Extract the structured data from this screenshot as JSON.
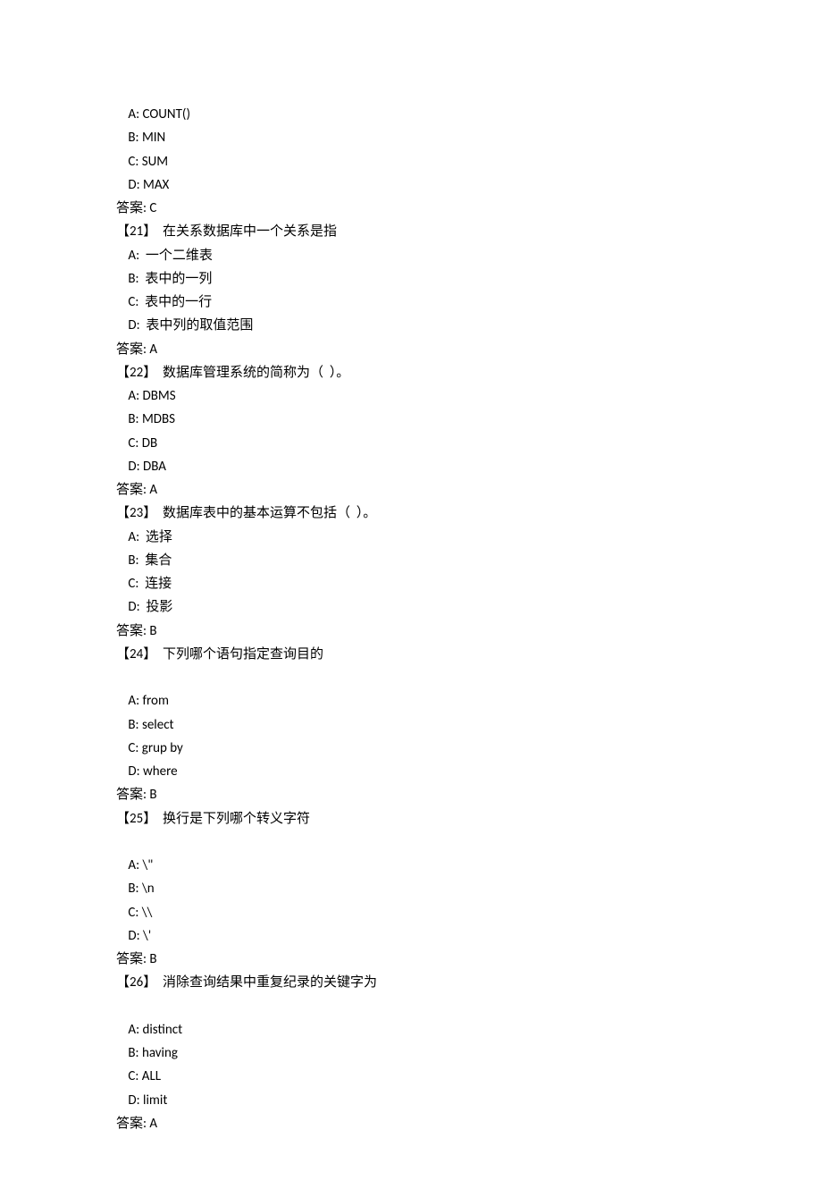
{
  "questions": [
    {
      "prior_options": [
        "A: COUNT()",
        "B: MIN",
        "C: SUM",
        "D: MAX"
      ],
      "answer_label": "答案: C"
    },
    {
      "header": "【21】  在关系数据库中一个关系是指",
      "options": [
        "A:  一个二维表",
        "B:  表中的一列",
        "C:  表中的一行",
        "D:  表中列的取值范围"
      ],
      "answer_label": "答案: A"
    },
    {
      "header": "【22】  数据库管理系统的简称为（  ）。",
      "options": [
        "A: DBMS",
        "B: MDBS",
        "C: DB",
        "D: DBA"
      ],
      "answer_label": "答案: A"
    },
    {
      "header": "【23】  数据库表中的基本运算不包括（  ）。",
      "options": [
        "A:  选择",
        "B:  集合",
        "C:  连接",
        "D:  投影"
      ],
      "answer_label": "答案: B"
    },
    {
      "header": "【24】  下列哪个语句指定查询目的",
      "blank_after_header": true,
      "options": [
        "A: from",
        "B: select",
        "C: grup by",
        "D: where"
      ],
      "answer_label": "答案: B"
    },
    {
      "header": "【25】  换行是下列哪个转义字符",
      "blank_after_header": true,
      "options": [
        "A: \\\"",
        "B: \\n",
        "C: \\\\",
        "D: \\'"
      ],
      "answer_label": "答案: B"
    },
    {
      "header": "【26】  消除查询结果中重复纪录的关键字为",
      "blank_after_header": true,
      "options": [
        "A: distinct",
        "B: having",
        "C: ALL",
        "D: limit"
      ],
      "answer_label": "答案: A"
    }
  ]
}
